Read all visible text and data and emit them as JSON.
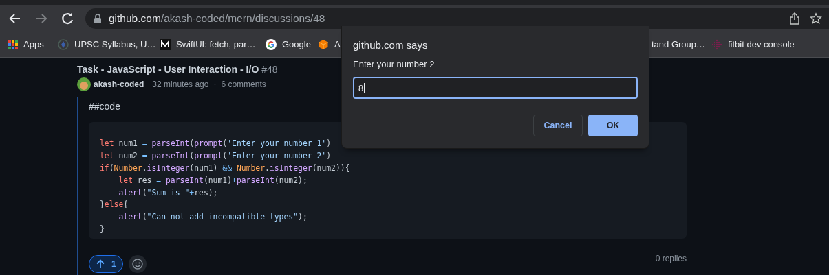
{
  "browser": {
    "back_enabled": true,
    "forward_enabled": false,
    "url_host": "github.com",
    "url_path": "/akash-coded/mern/discussions/48"
  },
  "bookmarks": [
    {
      "label": "Apps",
      "kind": "apps"
    },
    {
      "label": "UPSC Syllabus, U…",
      "kind": "emblem"
    },
    {
      "label": "SwiftUI: fetch, par…",
      "kind": "medium"
    },
    {
      "label": "Google",
      "kind": "google"
    },
    {
      "label": "A",
      "kind": "cube"
    },
    {
      "label": "tand Group…",
      "kind": "none"
    },
    {
      "label": "fitbit dev console",
      "kind": "dots"
    }
  ],
  "discussion": {
    "title": "Task - JavaScript - User Interaction - I/O",
    "number": "#48",
    "author": "akash-coded",
    "time": "32 minutes ago",
    "separator": "·",
    "comments": "6 comments"
  },
  "comment": {
    "heading": "##code",
    "code": [
      {
        "indented": false,
        "tokens": [
          {
            "text": "let",
            "kind": "keyword"
          },
          {
            "text": " num1 ",
            "kind": "plain"
          },
          {
            "text": "= ",
            "kind": "op"
          },
          {
            "text": "parseInt",
            "kind": "func"
          },
          {
            "text": "(",
            "kind": "plain"
          },
          {
            "text": "prompt",
            "kind": "func"
          },
          {
            "text": "(",
            "kind": "plain"
          },
          {
            "text": "'Enter your number 1'",
            "kind": "string"
          },
          {
            "text": ")",
            "kind": "plain"
          }
        ]
      },
      {
        "indented": false,
        "tokens": [
          {
            "text": "let",
            "kind": "keyword"
          },
          {
            "text": " num2 ",
            "kind": "plain"
          },
          {
            "text": "= ",
            "kind": "op"
          },
          {
            "text": "parseInt",
            "kind": "func"
          },
          {
            "text": "(",
            "kind": "plain"
          },
          {
            "text": "prompt",
            "kind": "func"
          },
          {
            "text": "(",
            "kind": "plain"
          },
          {
            "text": "'Enter your number 2'",
            "kind": "string"
          },
          {
            "text": ")",
            "kind": "plain"
          }
        ]
      },
      {
        "indented": false,
        "tokens": [
          {
            "text": "if",
            "kind": "keyword"
          },
          {
            "text": "(",
            "kind": "plain"
          },
          {
            "text": "Number",
            "kind": "class"
          },
          {
            "text": ".",
            "kind": "plain"
          },
          {
            "text": "isInteger",
            "kind": "func"
          },
          {
            "text": "(num1) ",
            "kind": "plain"
          },
          {
            "text": "&& ",
            "kind": "op"
          },
          {
            "text": "Number",
            "kind": "class"
          },
          {
            "text": ".",
            "kind": "plain"
          },
          {
            "text": "isInteger",
            "kind": "func"
          },
          {
            "text": "(num2)){",
            "kind": "plain"
          }
        ]
      },
      {
        "indented": true,
        "tokens": [
          {
            "text": "let",
            "kind": "keyword"
          },
          {
            "text": " res ",
            "kind": "plain"
          },
          {
            "text": "= ",
            "kind": "op"
          },
          {
            "text": "parseInt",
            "kind": "func"
          },
          {
            "text": "(num1)",
            "kind": "plain"
          },
          {
            "text": "+",
            "kind": "op"
          },
          {
            "text": "parseInt",
            "kind": "func"
          },
          {
            "text": "(num2);",
            "kind": "plain"
          }
        ]
      },
      {
        "indented": true,
        "tokens": [
          {
            "text": "alert",
            "kind": "func"
          },
          {
            "text": "(",
            "kind": "plain"
          },
          {
            "text": "\"Sum is \"",
            "kind": "string"
          },
          {
            "text": "+",
            "kind": "op"
          },
          {
            "text": "res);",
            "kind": "plain"
          }
        ]
      },
      {
        "indented": false,
        "tokens": [
          {
            "text": "}",
            "kind": "plain"
          },
          {
            "text": "else",
            "kind": "keyword"
          },
          {
            "text": "{",
            "kind": "plain"
          }
        ]
      },
      {
        "indented": true,
        "tokens": [
          {
            "text": "alert",
            "kind": "func"
          },
          {
            "text": "(",
            "kind": "plain"
          },
          {
            "text": "\"Can not add incompatible types\"",
            "kind": "string"
          },
          {
            "text": ");",
            "kind": "plain"
          }
        ]
      },
      {
        "indented": false,
        "tokens": [
          {
            "text": "}",
            "kind": "plain"
          }
        ]
      }
    ],
    "reactions": [
      {
        "kind": "upvote",
        "count": "1",
        "selected": true
      }
    ],
    "replies": "0 replies"
  },
  "dialog": {
    "title": "github.com says",
    "message": "Enter your number 2",
    "value": "8",
    "buttons": [
      {
        "label": "Cancel",
        "kind": "secondary"
      },
      {
        "label": "OK",
        "kind": "primary"
      }
    ]
  }
}
